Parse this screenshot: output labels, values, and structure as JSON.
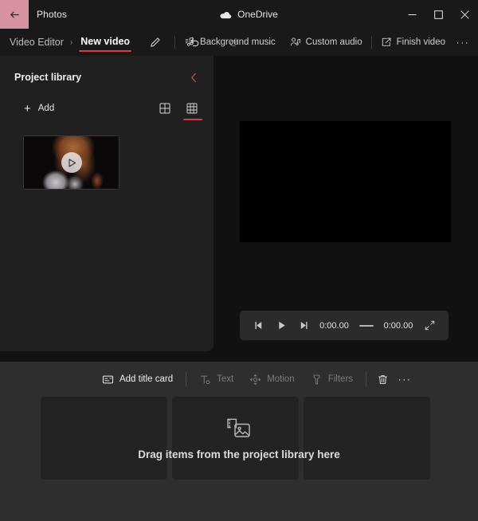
{
  "titlebar": {
    "back_label": "Back",
    "app_name": "Photos",
    "onedrive_label": "OneDrive",
    "minimize_label": "Minimize",
    "maximize_label": "Maximize",
    "close_label": "Close"
  },
  "commandbar": {
    "breadcrumb_parent": "Video Editor",
    "breadcrumb_separator": "›",
    "breadcrumb_current": "New video",
    "rename_label": "Rename",
    "undo_label": "Undo",
    "redo_label": "Redo",
    "background_music": "Background music",
    "custom_audio": "Custom audio",
    "finish_video": "Finish video",
    "more_label": "···"
  },
  "library": {
    "title": "Project library",
    "collapse_label": "Collapse",
    "add_label": "Add",
    "add_plus": "+",
    "view_large_label": "Large tiles view",
    "view_small_label": "Small tiles view",
    "items": [
      {
        "name": "video-thumbnail",
        "play_label": "Play"
      }
    ]
  },
  "preview": {
    "transport": {
      "previous_frame_label": "Previous frame",
      "play_label": "Play",
      "next_frame_label": "Next frame",
      "current_time": "0:00.00",
      "total_time": "0:00.00",
      "fullscreen_label": "Full screen"
    }
  },
  "storyboard": {
    "toolbar": [
      {
        "label": "Add title card",
        "icon": "title-card-icon",
        "disabled": false
      },
      {
        "label": "Text",
        "icon": "text-icon",
        "disabled": true
      },
      {
        "label": "Motion",
        "icon": "motion-icon",
        "disabled": true
      },
      {
        "label": "Filters",
        "icon": "filters-icon",
        "disabled": true
      }
    ],
    "delete_label": "Delete",
    "more_label": "···",
    "empty_text": "Drag items from the project library here",
    "cards": [
      {},
      {},
      {}
    ]
  },
  "colors": {
    "accent_red": "#dd3b44",
    "back_highlight": "#d7939f",
    "titlebar_bg": "#191919",
    "library_bg": "#202020",
    "stage_bg": "#111111",
    "storyboard_bg": "#2e2e2e",
    "card_bg": "#232323"
  }
}
